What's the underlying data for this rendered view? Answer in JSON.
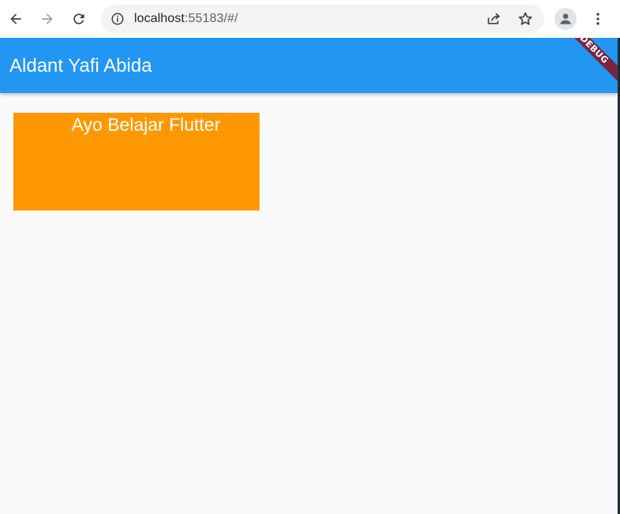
{
  "browser": {
    "url_host": "localhost",
    "url_rest": ":55183/#/",
    "back_icon": "arrow-left-icon",
    "forward_icon": "arrow-right-icon",
    "reload_icon": "reload-icon",
    "info_icon": "info-icon",
    "share_icon": "share-icon",
    "star_icon": "star-icon",
    "profile_icon": "profile-icon",
    "menu_icon": "kebab-menu-icon"
  },
  "appbar": {
    "title": "Aldant Yafi Abida",
    "color": "#2196f3",
    "debug_label": "DEBUG"
  },
  "body": {
    "box_text": "Ayo Belajar Flutter",
    "box_color": "#ff9800",
    "background": "#fafafa"
  }
}
